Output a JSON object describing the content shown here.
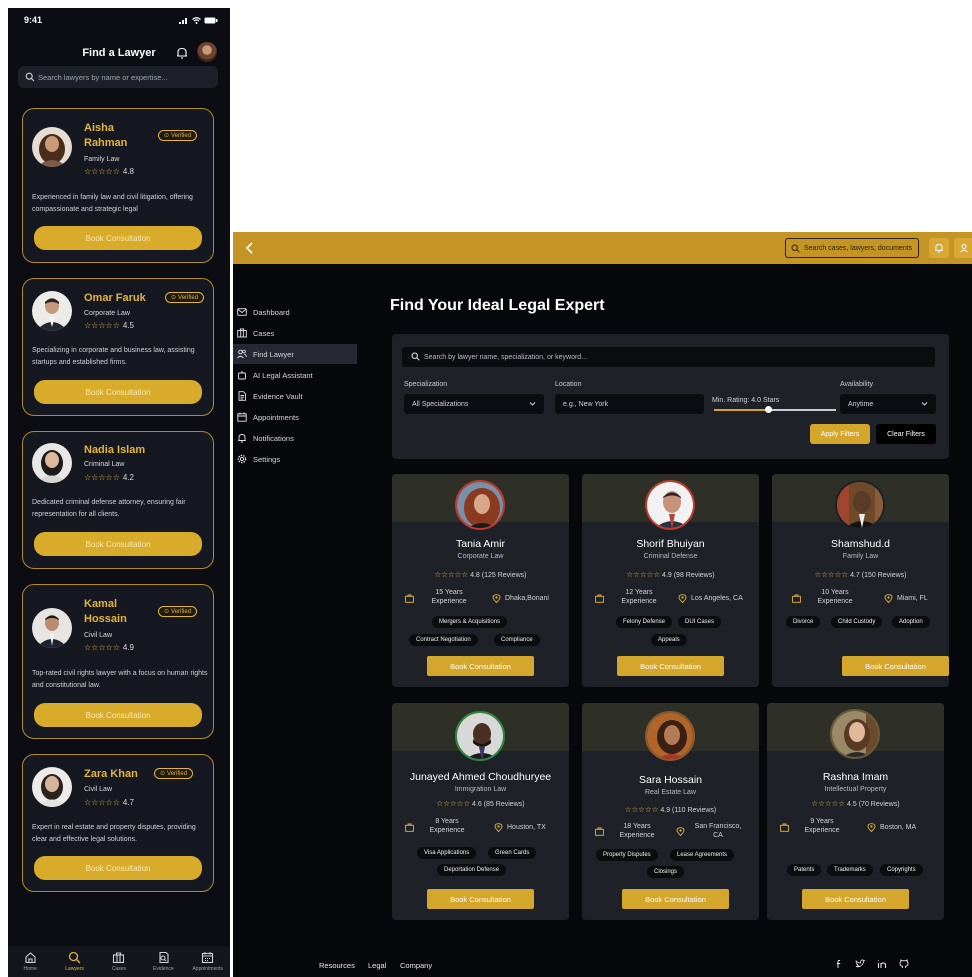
{
  "mobile": {
    "status": {
      "time": "9:41"
    },
    "header": {
      "title": "Find a Lawyer"
    },
    "search": {
      "placeholder": "Search lawyers by name or expertise..."
    },
    "lawyers": [
      {
        "name": "Aisha Rahman",
        "specialization": "Family Law",
        "rating": "4.8",
        "verified": "Verified",
        "bio": "Experienced in family law and civil litigation, offering compassionate and strategic legal",
        "button": "Book Consultation"
      },
      {
        "name": "Omar Faruk",
        "specialization": "Corporate Law",
        "rating": "4.5",
        "verified": "Verified",
        "bio": "Specializing in corporate and business law, assisting startups and established firms.",
        "button": "Book Consultation"
      },
      {
        "name": "Nadia Islam",
        "specialization": "Criminal Law",
        "rating": "4.2",
        "verified": "",
        "bio": "Dedicated criminal defense attorney, ensuring fair representation for all clients.",
        "button": "Book Consultation"
      },
      {
        "name": "Kamal Hossain",
        "specialization": "Civil Law",
        "rating": "4.9",
        "verified": "Verified",
        "bio": "Top-rated civil rights lawyer with a focus on human rights and constitutional law.",
        "button": "Book Consultation"
      },
      {
        "name": "Zara Khan",
        "specialization": "Civil Law",
        "rating": "4.7",
        "verified": "Verified",
        "bio": "Expert in real estate and property disputes, providing clear and effective legal solutions.",
        "button": "Book Consultation"
      }
    ],
    "nav": [
      {
        "label": "Home",
        "icon": "home-icon",
        "active": false
      },
      {
        "label": "Lawyers",
        "icon": "search-icon",
        "active": true
      },
      {
        "label": "Cases",
        "icon": "briefcase-icon",
        "active": false
      },
      {
        "label": "Evidence",
        "icon": "evidence-icon",
        "active": false
      },
      {
        "label": "Appointments",
        "icon": "calendar-icon",
        "active": false
      }
    ]
  },
  "desktop": {
    "topbar": {
      "search_placeholder": "Search cases, lawyers, documents"
    },
    "sidebar": [
      {
        "label": "Dashboard",
        "icon": "mail-icon",
        "active": false
      },
      {
        "label": "Cases",
        "icon": "briefcase-icon",
        "active": false
      },
      {
        "label": "Find Lawyer",
        "icon": "users-icon",
        "active": true
      },
      {
        "label": "AI Legal Assistant",
        "icon": "robot-icon",
        "active": false
      },
      {
        "label": "Evidence Vault",
        "icon": "document-icon",
        "active": false
      },
      {
        "label": "Appointments",
        "icon": "calendar-icon",
        "active": false
      },
      {
        "label": "Notifications",
        "icon": "bell-icon",
        "active": false
      },
      {
        "label": "Settings",
        "icon": "gear-icon",
        "active": false
      }
    ],
    "page_title": "Find Your Ideal Legal Expert",
    "filters": {
      "search_placeholder": "Search by lawyer name, specialization, or keyword...",
      "specialization_label": "Specialization",
      "specialization_value": "All Specializations",
      "location_label": "Location",
      "location_placeholder": "e.g., New York",
      "rating_label": "Min. Rating: 4.0 Stars",
      "rating_value": 4.0,
      "rating_max": 5,
      "availability_label": "Availability",
      "availability_value": "Anytime",
      "apply": "Apply Filters",
      "clear": "Clear Filters"
    },
    "lawyers": [
      {
        "name": "Tania Amir",
        "specialization": "Corporate Law",
        "rating": "4.8 (125 Reviews)",
        "experience": "15 Years Experience",
        "location": "Dhaka,Bonani",
        "tags": [
          "Mergers & Acquisitions",
          "Contract Negotiation",
          "Compliance"
        ],
        "button": "Book Consultation"
      },
      {
        "name": "Shorif Bhuiyan",
        "specialization": "Criminal Defense",
        "rating": "4.9 (98 Reviews)",
        "experience": "12 Years Experience",
        "location": "Los Angeles, CA",
        "tags": [
          "Felony Defense",
          "DUI Cases",
          "Appeals"
        ],
        "button": "Book Consultation"
      },
      {
        "name": "Shamshud.d",
        "specialization": "Family Law",
        "rating": "4.7 (150 Reviews)",
        "experience": "10 Years Experience",
        "location": "Miami, FL",
        "tags": [
          "Divorce",
          "Child Custody",
          "Adoption"
        ],
        "button": "Book Consultation"
      },
      {
        "name": "Junayed Ahmed Choudhuryee",
        "specialization": "Immigration Law",
        "rating": "4.6 (85 Reviews)",
        "experience": "8 Years Experience",
        "location": "Houston, TX",
        "tags": [
          "Visa Applications",
          "Green Cards",
          "Deportation Defense"
        ],
        "button": "Book Consultation"
      },
      {
        "name": "Sara Hossain",
        "specialization": "Real Estate Law",
        "rating": "4.9 (110 Reviews)",
        "experience": "18 Years Experience",
        "location": "San Francisco, CA",
        "tags": [
          "Property Disputes",
          "Lease Agreements",
          "Closings"
        ],
        "button": "Book Consultation"
      },
      {
        "name": "Rashna Imam",
        "specialization": "Intellectual Property",
        "rating": "4.5 (70 Reviews)",
        "experience": "9 Years Experience",
        "location": "Boston, MA",
        "tags": [
          "Patents",
          "Trademarks",
          "Copyrights"
        ],
        "button": "Book Consultation"
      }
    ],
    "footer": {
      "links": [
        "Resources",
        "Legal",
        "Company"
      ],
      "social": [
        "facebook-icon",
        "twitter-icon",
        "linkedin-icon",
        "github-icon"
      ]
    }
  },
  "colors": {
    "accent": "#d4a72c",
    "topbar": "#c49524",
    "background": "#07080b",
    "card": "#1f2129"
  }
}
